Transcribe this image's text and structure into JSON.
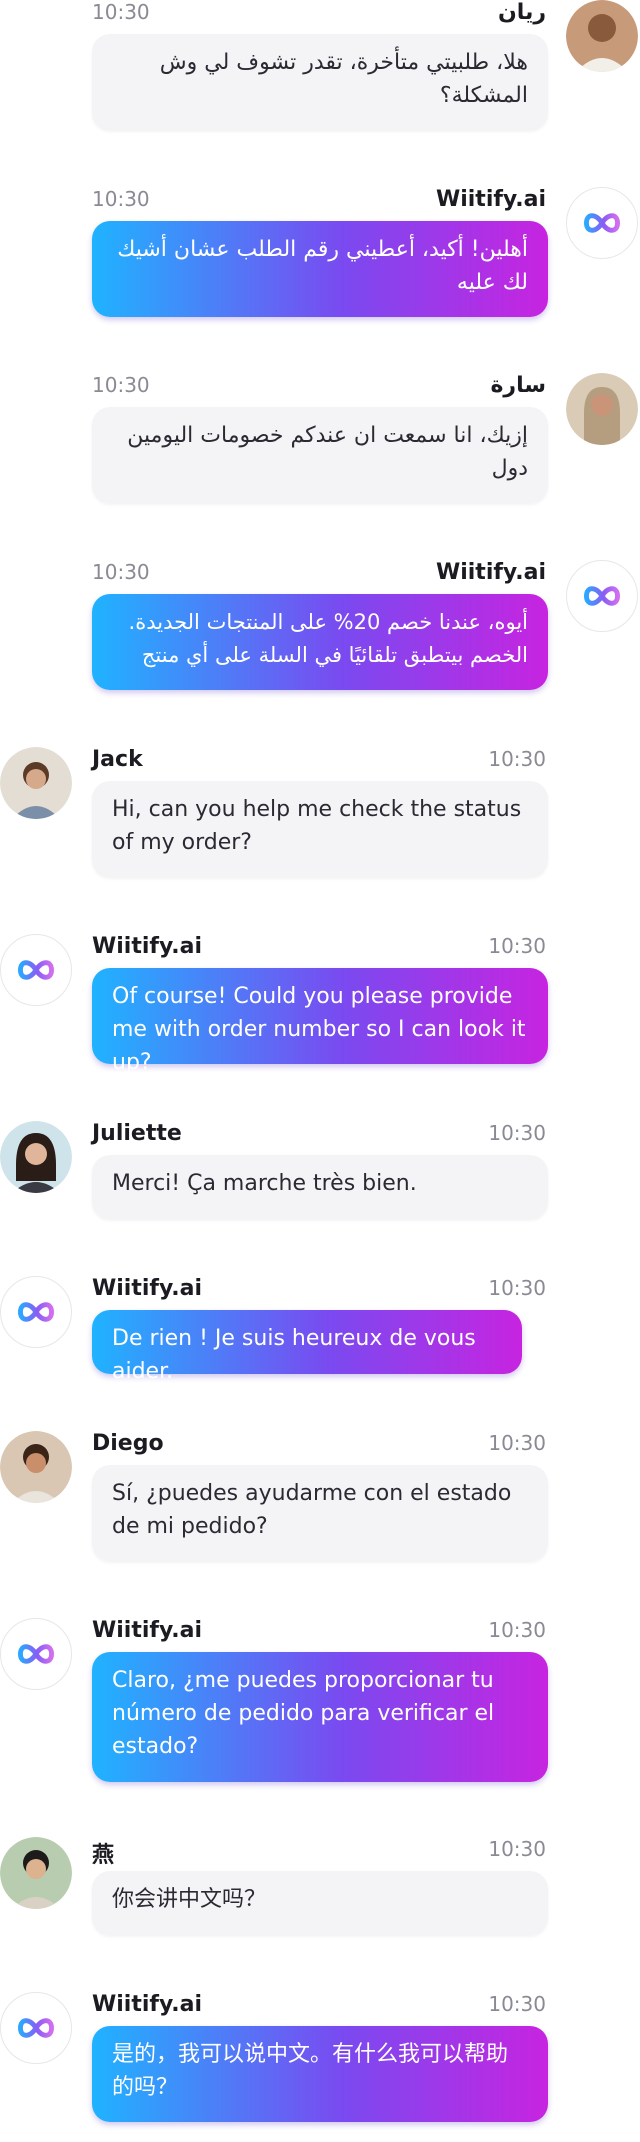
{
  "brand": {
    "gradient_start": "#1fb3ff",
    "gradient_end": "#c724e0"
  },
  "messages": [
    {
      "author": "ريان",
      "time": "10:30",
      "text": "هلا، طلبيتي متأخرة، تقدر تشوف لي وش المشكلة؟",
      "role": "user",
      "avatar": "person-avatar"
    },
    {
      "author": "Wiitify.ai",
      "time": "10:30",
      "text": "أهلين! أكيد، أعطيني رقم الطلب عشان أشيك لك عليه",
      "role": "bot",
      "avatar": "infinity-logo-icon"
    },
    {
      "author": "سارة",
      "time": "10:30",
      "text": "إزيك، انا سمعت ان عندكم خصومات اليومين دول",
      "role": "user",
      "avatar": "person-avatar"
    },
    {
      "author": "Wiitify.ai",
      "time": "10:30",
      "text": "أيوه، عندنا خصم 20% على المنتجات الجديدة. الخصم بيتطبق تلقائيًا في السلة على أي منتج",
      "role": "bot",
      "avatar": "infinity-logo-icon"
    },
    {
      "author": "Jack",
      "time": "10:30",
      "text": "Hi, can you help me check the status of my order?",
      "role": "user",
      "avatar": "person-avatar"
    },
    {
      "author": "Wiitify.ai",
      "time": "10:30",
      "text": "Of course! Could you please provide me with order number so I can look it up?",
      "role": "bot",
      "avatar": "infinity-logo-icon"
    },
    {
      "author": "Juliette",
      "time": "10:30",
      "text": "Merci! Ça marche très bien.",
      "role": "user",
      "avatar": "person-avatar"
    },
    {
      "author": "Wiitify.ai",
      "time": "10:30",
      "text": "De rien ! Je suis heureux de vous aider.",
      "role": "bot",
      "avatar": "infinity-logo-icon"
    },
    {
      "author": "Diego",
      "time": "10:30",
      "text": "Sí, ¿puedes ayudarme con el estado de mi pedido?",
      "role": "user",
      "avatar": "person-avatar"
    },
    {
      "author": "Wiitify.ai",
      "time": "10:30",
      "text": "Claro, ¿me puedes proporcionar tu número de pedido para verificar el estado?",
      "role": "bot",
      "avatar": "infinity-logo-icon"
    },
    {
      "author": "燕",
      "time": "10:30",
      "text": "你会讲中文吗？",
      "role": "user",
      "avatar": "person-avatar"
    },
    {
      "author": "Wiitify.ai",
      "time": "10:30",
      "text": "是的，我可以说中文。有什么我可以帮助的吗？",
      "role": "bot",
      "avatar": "infinity-logo-icon"
    }
  ]
}
